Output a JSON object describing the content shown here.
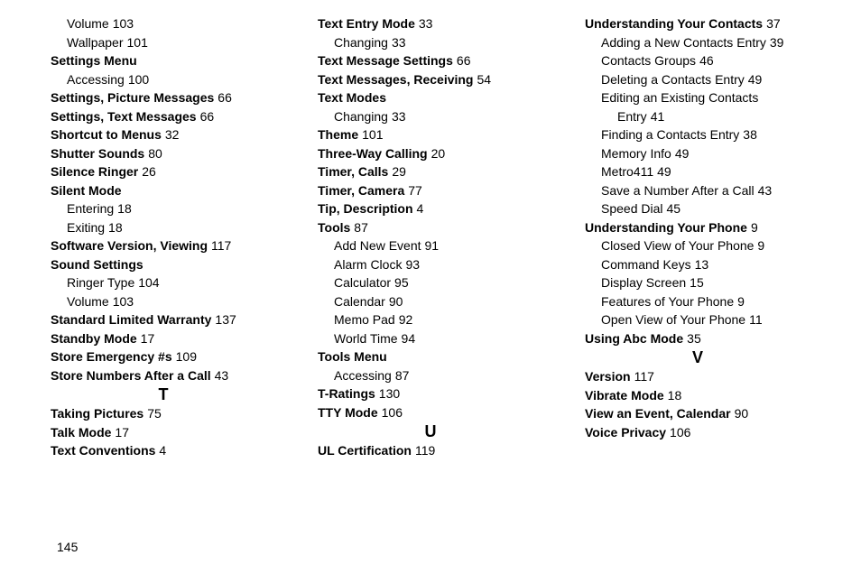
{
  "page_number": "145",
  "col1": [
    {
      "t": "sub",
      "b": "",
      "l": "Volume",
      "p": "103"
    },
    {
      "t": "sub",
      "b": "",
      "l": "Wallpaper",
      "p": "101"
    },
    {
      "t": "top",
      "b": "1",
      "l": "Settings Menu",
      "p": ""
    },
    {
      "t": "sub",
      "b": "",
      "l": "Accessing",
      "p": "100"
    },
    {
      "t": "top",
      "b": "1",
      "l": "Settings, Picture Messages",
      "p": "66"
    },
    {
      "t": "top",
      "b": "1",
      "l": "Settings, Text Messages",
      "p": "66"
    },
    {
      "t": "top",
      "b": "1",
      "l": "Shortcut to Menus",
      "p": "32"
    },
    {
      "t": "top",
      "b": "1",
      "l": "Shutter Sounds",
      "p": "80"
    },
    {
      "t": "top",
      "b": "1",
      "l": "Silence Ringer",
      "p": "26"
    },
    {
      "t": "top",
      "b": "1",
      "l": "Silent Mode",
      "p": ""
    },
    {
      "t": "sub",
      "b": "",
      "l": "Entering",
      "p": "18"
    },
    {
      "t": "sub",
      "b": "",
      "l": "Exiting",
      "p": "18"
    },
    {
      "t": "top",
      "b": "1",
      "l": "Software Version, Viewing",
      "p": "117"
    },
    {
      "t": "top",
      "b": "1",
      "l": "Sound Settings",
      "p": ""
    },
    {
      "t": "sub",
      "b": "",
      "l": "Ringer Type",
      "p": "104"
    },
    {
      "t": "sub",
      "b": "",
      "l": "Volume",
      "p": "103"
    },
    {
      "t": "top",
      "b": "1",
      "l": "Standard Limited Warranty",
      "p": "137"
    },
    {
      "t": "top",
      "b": "1",
      "l": "Standby Mode",
      "p": "17"
    },
    {
      "t": "top",
      "b": "1",
      "l": "Store Emergency #s",
      "p": "109"
    },
    {
      "t": "top",
      "b": "1",
      "l": "Store Numbers After a Call",
      "p": "43"
    },
    {
      "t": "letter",
      "l": "T"
    },
    {
      "t": "top",
      "b": "1",
      "l": "Taking Pictures",
      "p": "75"
    },
    {
      "t": "top",
      "b": "1",
      "l": "Talk Mode",
      "p": "17"
    },
    {
      "t": "top",
      "b": "1",
      "l": "Text Conventions",
      "p": "4"
    }
  ],
  "col2": [
    {
      "t": "top",
      "b": "1",
      "l": "Text Entry Mode",
      "p": "33"
    },
    {
      "t": "sub",
      "b": "",
      "l": "Changing",
      "p": "33"
    },
    {
      "t": "top",
      "b": "1",
      "l": "Text Message Settings",
      "p": "66"
    },
    {
      "t": "top",
      "b": "1",
      "l": "Text Messages, Receiving",
      "p": "54"
    },
    {
      "t": "top",
      "b": "1",
      "l": "Text Modes",
      "p": ""
    },
    {
      "t": "sub",
      "b": "",
      "l": "Changing",
      "p": "33"
    },
    {
      "t": "top",
      "b": "1",
      "l": "Theme",
      "p": "101"
    },
    {
      "t": "top",
      "b": "1",
      "l": "Three-Way Calling",
      "p": "20"
    },
    {
      "t": "top",
      "b": "1",
      "l": "Timer, Calls",
      "p": "29"
    },
    {
      "t": "top",
      "b": "1",
      "l": "Timer, Camera",
      "p": "77"
    },
    {
      "t": "top",
      "b": "1",
      "l": "Tip, Description",
      "p": "4"
    },
    {
      "t": "top",
      "b": "1",
      "l": "Tools",
      "p": "87"
    },
    {
      "t": "sub",
      "b": "",
      "l": "Add New Event",
      "p": "91"
    },
    {
      "t": "sub",
      "b": "",
      "l": "Alarm Clock",
      "p": "93"
    },
    {
      "t": "sub",
      "b": "",
      "l": "Calculator",
      "p": "95"
    },
    {
      "t": "sub",
      "b": "",
      "l": "Calendar",
      "p": "90"
    },
    {
      "t": "sub",
      "b": "",
      "l": "Memo Pad",
      "p": "92"
    },
    {
      "t": "sub",
      "b": "",
      "l": "World Time",
      "p": "94"
    },
    {
      "t": "top",
      "b": "1",
      "l": "Tools Menu",
      "p": ""
    },
    {
      "t": "sub",
      "b": "",
      "l": "Accessing",
      "p": "87"
    },
    {
      "t": "top",
      "b": "1",
      "l": "T-Ratings",
      "p": "130"
    },
    {
      "t": "top",
      "b": "1",
      "l": "TTY Mode",
      "p": "106"
    },
    {
      "t": "letter",
      "l": "U"
    },
    {
      "t": "top",
      "b": "1",
      "l": "UL Certification",
      "p": "119"
    }
  ],
  "col3": [
    {
      "t": "top",
      "b": "1",
      "l": "Understanding Your Contacts",
      "p": "37"
    },
    {
      "t": "sub",
      "b": "",
      "l": "Adding a New Contacts Entry",
      "p": "39"
    },
    {
      "t": "sub",
      "b": "",
      "l": "Contacts Groups",
      "p": "46"
    },
    {
      "t": "sub",
      "b": "",
      "l": "Deleting a Contacts Entry",
      "p": "49"
    },
    {
      "t": "sub",
      "b": "",
      "l": "Editing an Existing Contacts",
      "p": ""
    },
    {
      "t": "sub2",
      "b": "",
      "l": "Entry",
      "p": "41"
    },
    {
      "t": "sub",
      "b": "",
      "l": "Finding a Contacts Entry",
      "p": "38"
    },
    {
      "t": "sub",
      "b": "",
      "l": "Memory Info",
      "p": "49"
    },
    {
      "t": "sub",
      "b": "",
      "l": "Metro411",
      "p": "49"
    },
    {
      "t": "sub",
      "b": "",
      "l": "Save a Number After a Call",
      "p": "43"
    },
    {
      "t": "sub",
      "b": "",
      "l": "Speed Dial",
      "p": "45"
    },
    {
      "t": "top",
      "b": "1",
      "l": "Understanding Your Phone",
      "p": "9"
    },
    {
      "t": "sub",
      "b": "",
      "l": "Closed View of Your Phone",
      "p": "9"
    },
    {
      "t": "sub",
      "b": "",
      "l": "Command Keys",
      "p": "13"
    },
    {
      "t": "sub",
      "b": "",
      "l": "Display Screen",
      "p": "15"
    },
    {
      "t": "sub",
      "b": "",
      "l": "Features of Your Phone",
      "p": "9"
    },
    {
      "t": "sub",
      "b": "",
      "l": "Open View of Your Phone",
      "p": "11"
    },
    {
      "t": "top",
      "b": "1",
      "l": "Using Abc Mode",
      "p": "35"
    },
    {
      "t": "letter",
      "l": "V"
    },
    {
      "t": "top",
      "b": "1",
      "l": "Version",
      "p": "117"
    },
    {
      "t": "top",
      "b": "1",
      "l": "Vibrate Mode",
      "p": "18"
    },
    {
      "t": "top",
      "b": "1",
      "l": "View an Event, Calendar",
      "p": "90"
    },
    {
      "t": "top",
      "b": "1",
      "l": "Voice Privacy",
      "p": "106"
    }
  ]
}
